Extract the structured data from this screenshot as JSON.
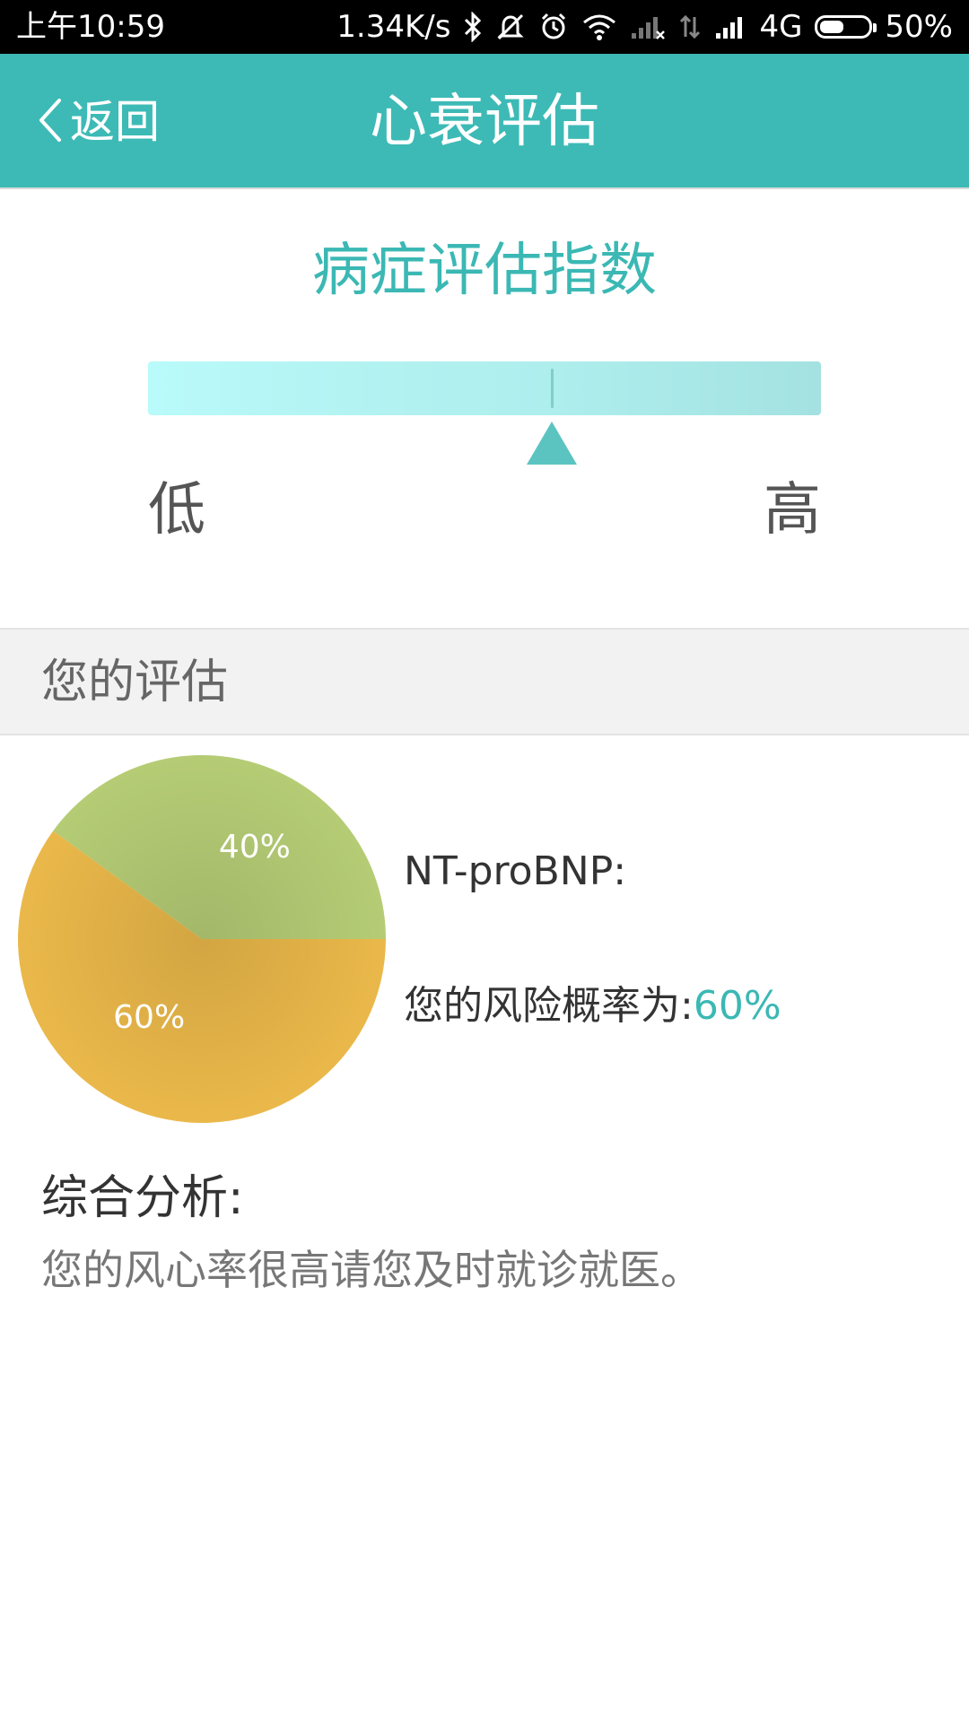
{
  "status_bar": {
    "time": "上午10:59",
    "speed": "1.34K/s",
    "network": "4G",
    "battery": "50%",
    "battery_level": 50
  },
  "nav": {
    "back_label": "返回",
    "title": "心衰评估"
  },
  "index": {
    "title": "病症评估指数",
    "low_label": "低",
    "high_label": "高",
    "level": 0.6
  },
  "assessment": {
    "header": "您的评估",
    "nt_label": "NT-proBNP:",
    "risk_label": "您的风险概率为:",
    "risk_value": "60%"
  },
  "chart_data": {
    "type": "pie",
    "slices": [
      {
        "label": "40%",
        "value": 40,
        "color": "#b5cc75"
      },
      {
        "label": "60%",
        "value": 60,
        "color": "#eab84a"
      }
    ]
  },
  "analysis": {
    "title": "综合分析:",
    "text": "您的风心率很高请您及时就诊就医。"
  },
  "colors": {
    "accent": "#3dbab6",
    "text_accent": "#3bb8b4"
  }
}
